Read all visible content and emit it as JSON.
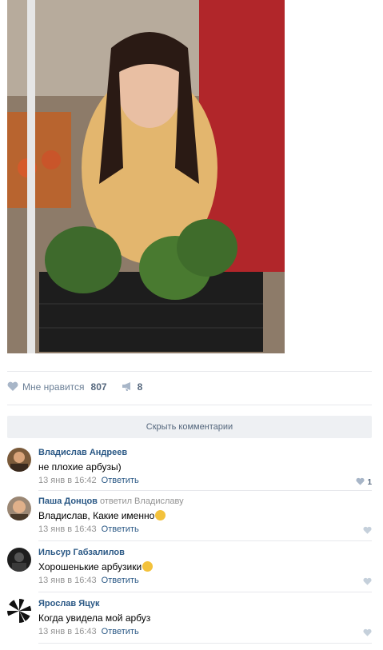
{
  "post": {
    "image_alt": "photo",
    "likes_label": "Мне нравится",
    "likes_count": "807",
    "reposts_count": "8"
  },
  "hide_comments_label": "Скрыть комментарии",
  "comments": [
    {
      "author": "Владислав Андреев",
      "reply_to": "",
      "text": "не плохие арбузы)",
      "date": "13 янв в 16:42",
      "reply_label": "Ответить",
      "likes": "1"
    },
    {
      "author": "Паша Донцов",
      "reply_to": "ответил Владиславу",
      "text": "Владислав, Какие именно",
      "date": "13 янв в 16:43",
      "reply_label": "Ответить",
      "likes": ""
    },
    {
      "author": "Ильсур Габзалилов",
      "reply_to": "",
      "text": "Хорошенькие арбузики",
      "date": "13 янв в 16:43",
      "reply_label": "Ответить",
      "likes": ""
    },
    {
      "author": "Ярослав Яцук",
      "reply_to": "",
      "text": "Когда увидела мой арбуз",
      "date": "13 янв в 16:43",
      "reply_label": "Ответить",
      "likes": ""
    }
  ],
  "colors": {
    "link": "#2a5885",
    "muted": "#939393",
    "separator": "#e7e8ec",
    "button_bg": "#eef0f3"
  }
}
